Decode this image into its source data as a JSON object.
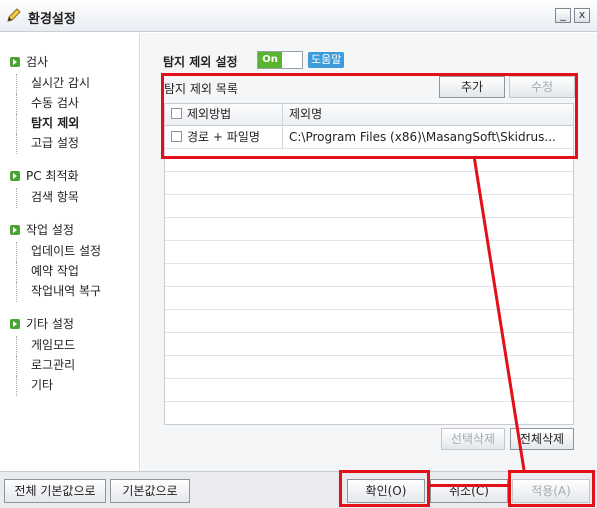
{
  "window": {
    "title": "환경설정",
    "minimize_label": "_",
    "close_label": "x"
  },
  "sidebar": {
    "groups": [
      {
        "label": "검사",
        "items": [
          "실시간 감시",
          "수동 검사",
          "탐지 제외",
          "고급 설정"
        ]
      },
      {
        "label": "PC 최적화",
        "items": [
          "검색 항목"
        ]
      },
      {
        "label": "작업 설정",
        "items": [
          "업데이트 설정",
          "예약 작업",
          "작업내역 복구"
        ]
      },
      {
        "label": "기타 설정",
        "items": [
          "게임모드",
          "로그관리",
          "기타"
        ]
      }
    ],
    "active_item": "탐지 제외"
  },
  "main": {
    "section_title": "탐지 제외 설정",
    "toggle_label": "On",
    "help_label": "도움말",
    "list_title": "탐지 제외 목록",
    "add_button": "추가",
    "edit_button": "수정",
    "columns": [
      "제외방법",
      "제외명"
    ],
    "rows": [
      {
        "method": "경로 + 파일명",
        "name": "C:\\Program Files (x86)\\MasangSoft\\Skidrus..."
      }
    ],
    "delete_selected_button": "선택삭제",
    "delete_all_button": "전체삭제"
  },
  "footer": {
    "reset_all_button": "전체 기본값으로",
    "reset_button": "기본값으로",
    "ok_button": "확인(O)",
    "cancel_button": "취소(C)",
    "apply_button": "적용(A)"
  },
  "colors": {
    "highlight": "#e3101a",
    "toggle_on": "#5ab52e",
    "help_badge": "#3d9bd9"
  }
}
